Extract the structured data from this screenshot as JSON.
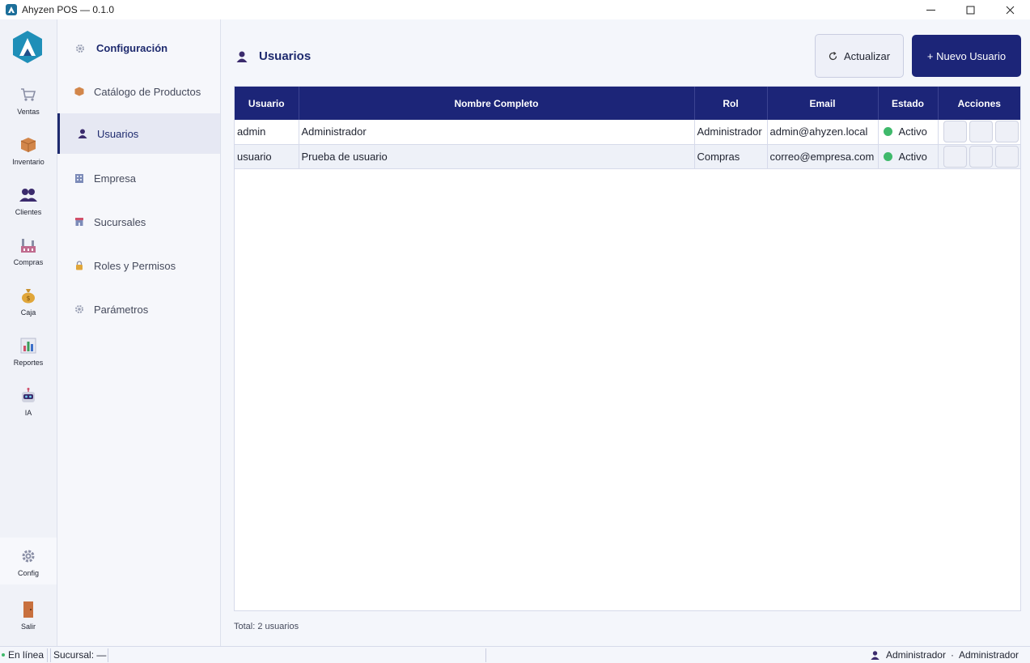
{
  "window": {
    "title": "Ahyzen POS — 0.1.0"
  },
  "rail": {
    "items": [
      {
        "label": "Ventas",
        "icon": "cart-icon"
      },
      {
        "label": "Inventario",
        "icon": "box-icon"
      },
      {
        "label": "Clientes",
        "icon": "people-icon"
      },
      {
        "label": "Compras",
        "icon": "factory-icon"
      },
      {
        "label": "Caja",
        "icon": "money-bag-icon"
      },
      {
        "label": "Reportes",
        "icon": "bar-chart-icon"
      },
      {
        "label": "IA",
        "icon": "robot-icon"
      }
    ],
    "config_label": "Config",
    "exit_label": "Salir"
  },
  "subnav": {
    "title": "Configuración",
    "items": [
      {
        "label": "Catálogo de Productos"
      },
      {
        "label": "Usuarios"
      },
      {
        "label": "Empresa"
      },
      {
        "label": "Sucursales"
      },
      {
        "label": "Roles y Permisos"
      },
      {
        "label": "Parámetros"
      }
    ]
  },
  "main": {
    "title": "Usuarios",
    "refresh_label": "Actualizar",
    "new_label": "+ Nuevo Usuario",
    "table": {
      "headers": [
        "Usuario",
        "Nombre Completo",
        "Rol",
        "Email",
        "Estado",
        "Acciones"
      ],
      "rows": [
        {
          "usuario": "admin",
          "nombre": "Administrador",
          "rol": "Administrador",
          "email": "admin@ahyzen.local",
          "estado": "Activo"
        },
        {
          "usuario": "usuario",
          "nombre": "Prueba de usuario",
          "rol": "Compras",
          "email": "correo@empresa.com",
          "estado": "Activo"
        }
      ]
    },
    "total": "Total: 2 usuarios"
  },
  "statusbar": {
    "online": "En línea",
    "branch": "Sucursal: —",
    "user_role": "Administrador",
    "user_name": "Administrador",
    "separator": "·"
  },
  "colors": {
    "accent": "#1c2578",
    "active_status": "#3fb96b"
  }
}
